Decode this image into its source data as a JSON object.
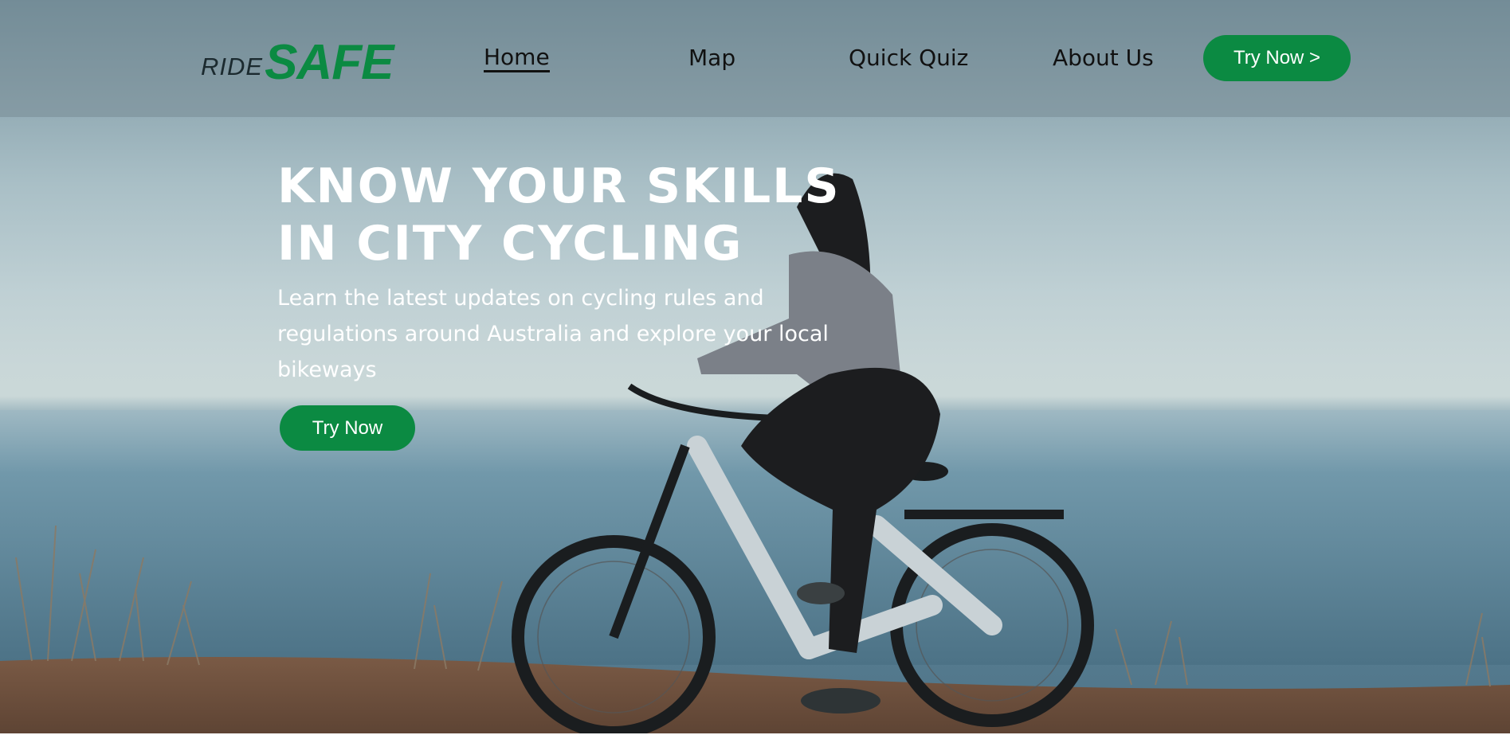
{
  "brand": {
    "logo_ride": "RIDE",
    "logo_safe": "SAFE",
    "accent_color": "#0b8a42"
  },
  "nav": {
    "items": [
      {
        "label": "Home",
        "active": true
      },
      {
        "label": "Map",
        "active": false
      },
      {
        "label": "Quick Quiz",
        "active": false
      },
      {
        "label": "About Us",
        "active": false
      }
    ],
    "cta_label": "Try Now >"
  },
  "hero": {
    "title": "Know your skills in city cycling",
    "subtitle": "Learn the latest updates on cycling rules and regulations around Australia and explore your local bikeways",
    "cta_label": "Try Now",
    "background": "woman riding an e-bike on a seaside cliff path"
  }
}
